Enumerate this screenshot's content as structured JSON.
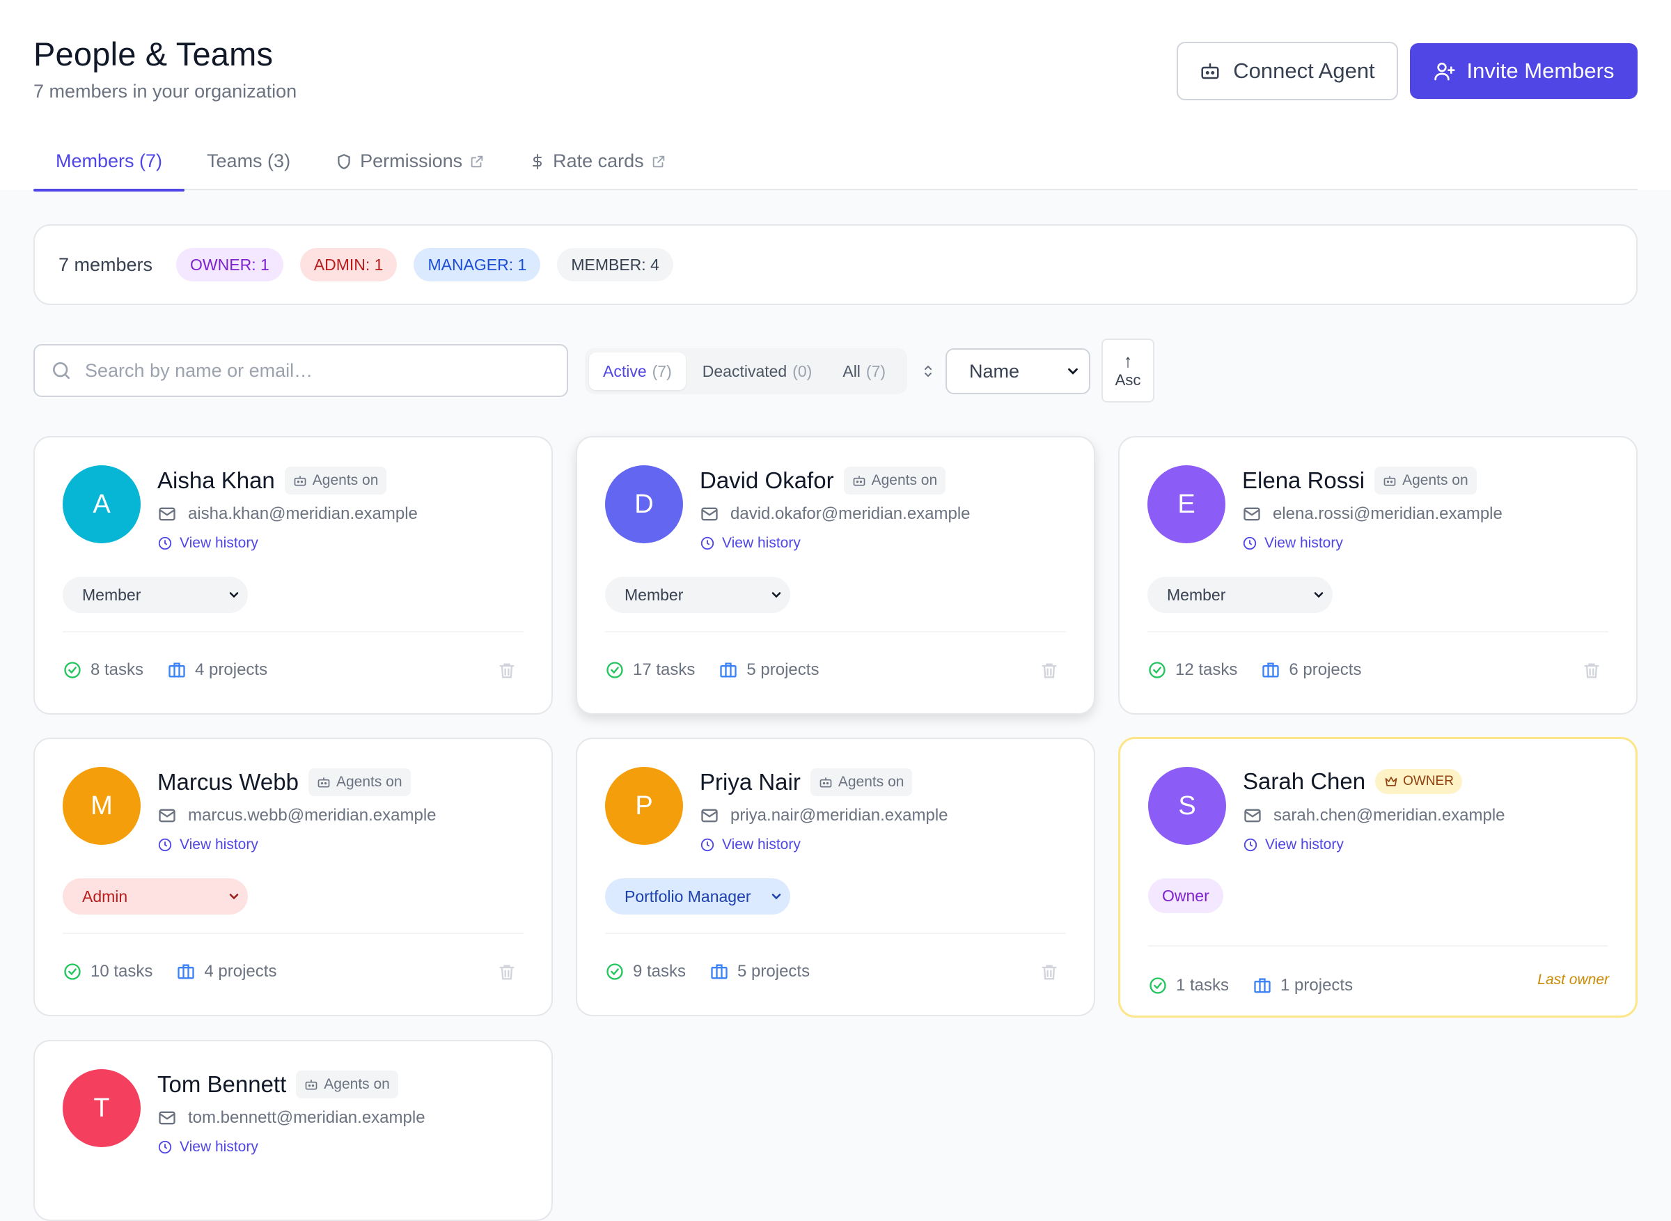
{
  "header": {
    "title": "People & Teams",
    "subtitle": "7 members in your organization",
    "connect_label": "Connect Agent",
    "invite_label": "Invite Members"
  },
  "tabs": [
    {
      "label": "Members (7)",
      "active": true,
      "icon": ""
    },
    {
      "label": "Teams (3)",
      "active": false,
      "icon": ""
    },
    {
      "label": "Permissions",
      "active": false,
      "icon": "shield-icon",
      "external": true
    },
    {
      "label": "Rate cards",
      "active": false,
      "icon": "dollar-icon",
      "external": true
    }
  ],
  "summary": {
    "count": "7 members",
    "pills": {
      "owner": "OWNER: 1",
      "admin": "ADMIN: 1",
      "manager": "MANAGER: 1",
      "member": "MEMBER: 4"
    }
  },
  "filters": {
    "search_placeholder": "Search by name or email…",
    "segments": [
      {
        "label": "Active",
        "count": "(7)",
        "active": true
      },
      {
        "label": "Deactivated",
        "count": "(0)",
        "active": false
      },
      {
        "label": "All",
        "count": "(7)",
        "active": false
      }
    ],
    "sort_value": "Name",
    "order_label": "Asc",
    "order_arrow": "↑"
  },
  "members": [
    {
      "initial": "A",
      "name": "Aisha Khan",
      "email": "aisha.khan@meridian.example",
      "badge": "Agents on",
      "history": "View history",
      "role": "Member",
      "tasks": "8 tasks",
      "projects": "4 projects",
      "color": "#06b6d4"
    },
    {
      "initial": "D",
      "name": "David Okafor",
      "email": "david.okafor@meridian.example",
      "badge": "Agents on",
      "history": "View history",
      "role": "Member",
      "tasks": "17 tasks",
      "projects": "5 projects",
      "color": "#6366f1"
    },
    {
      "initial": "E",
      "name": "Elena Rossi",
      "email": "elena.rossi@meridian.example",
      "badge": "Agents on",
      "history": "View history",
      "role": "Member",
      "tasks": "12 tasks",
      "projects": "6 projects",
      "color": "#8b5cf6"
    },
    {
      "initial": "M",
      "name": "Marcus Webb",
      "email": "marcus.webb@meridian.example",
      "badge": "Agents on",
      "history": "View history",
      "role": "Admin",
      "tasks": "10 tasks",
      "projects": "4 projects",
      "color": "#f59e0b"
    },
    {
      "initial": "P",
      "name": "Priya Nair",
      "email": "priya.nair@meridian.example",
      "badge": "Agents on",
      "history": "View history",
      "role": "Portfolio Manager",
      "tasks": "9 tasks",
      "projects": "5 projects",
      "color": "#f59e0b"
    },
    {
      "initial": "S",
      "name": "Sarah Chen",
      "email": "sarah.chen@meridian.example",
      "badge": "OWNER",
      "history": "View history",
      "role": "Owner",
      "tasks": "1 tasks",
      "projects": "1 projects",
      "note": "Last owner",
      "color": "#8b5cf6"
    },
    {
      "initial": "T",
      "name": "Tom Bennett",
      "email": "tom.bennett@meridian.example",
      "badge": "Agents on",
      "history": "View history",
      "color": "#f43f5e"
    }
  ],
  "colors": {
    "accent": "#4f46e5",
    "success": "#22c55e",
    "project": "#3b82f6"
  }
}
